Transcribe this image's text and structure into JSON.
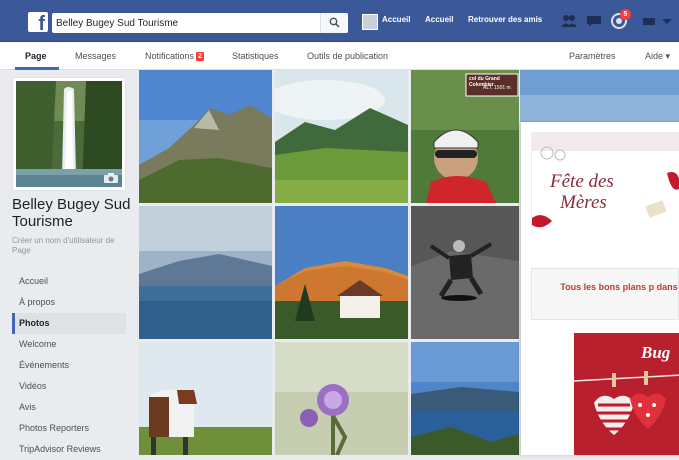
{
  "topbar": {
    "logo": "f",
    "search_value": "Belley Bugey Sud Tourisme",
    "nav_links": [
      "Accueil",
      "Accueil",
      "Retrouver des amis"
    ],
    "notif_badge": "5",
    "icons": [
      "friend-requests-icon",
      "messages-icon",
      "notifications-icon",
      "help-icon",
      "account-menu-icon"
    ]
  },
  "subnav": {
    "tabs": [
      "Page",
      "Messages",
      "Notifications",
      "Statistiques",
      "Outils de publication"
    ],
    "notifications_badge": "2",
    "right_tabs": [
      "Paramètres",
      "Aide ▾"
    ]
  },
  "sidebar": {
    "page_name": "Belley Bugey Sud Tourisme",
    "username_prompt": "Créer un nom d'utilisateur de Page",
    "items": [
      "Accueil",
      "À propos",
      "Photos",
      "Welcome",
      "Événements",
      "Vidéos",
      "Avis",
      "Photos Reporters",
      "TripAdvisor Reviews"
    ],
    "active_item": "Photos"
  },
  "photos": [
    {
      "subject": "mountain-ridge"
    },
    {
      "subject": "green-valley"
    },
    {
      "subject": "cyclist-selfie",
      "sign_text": "col du Grand Colombier",
      "sign_alt": "ALT. 1501 m"
    },
    {
      "subject": "sky-partial"
    },
    {
      "subject": "lake-and-mountain"
    },
    {
      "subject": "chalet-sunset"
    },
    {
      "subject": "skateboarder"
    },
    {
      "subject": "cow-in-field"
    },
    {
      "subject": "thistle-flower"
    },
    {
      "subject": "lake-view"
    }
  ],
  "popup": {
    "ad_title_line1": "Fête des",
    "ad_title_line2": "Mères",
    "ad_text": "Tous les bons plans p dans",
    "ad_brand": "Bug"
  },
  "colors": {
    "topbar": "#3b5998",
    "accent": "#4267b2",
    "badge": "#fa3e3e",
    "ad_red": "#b8202e"
  }
}
